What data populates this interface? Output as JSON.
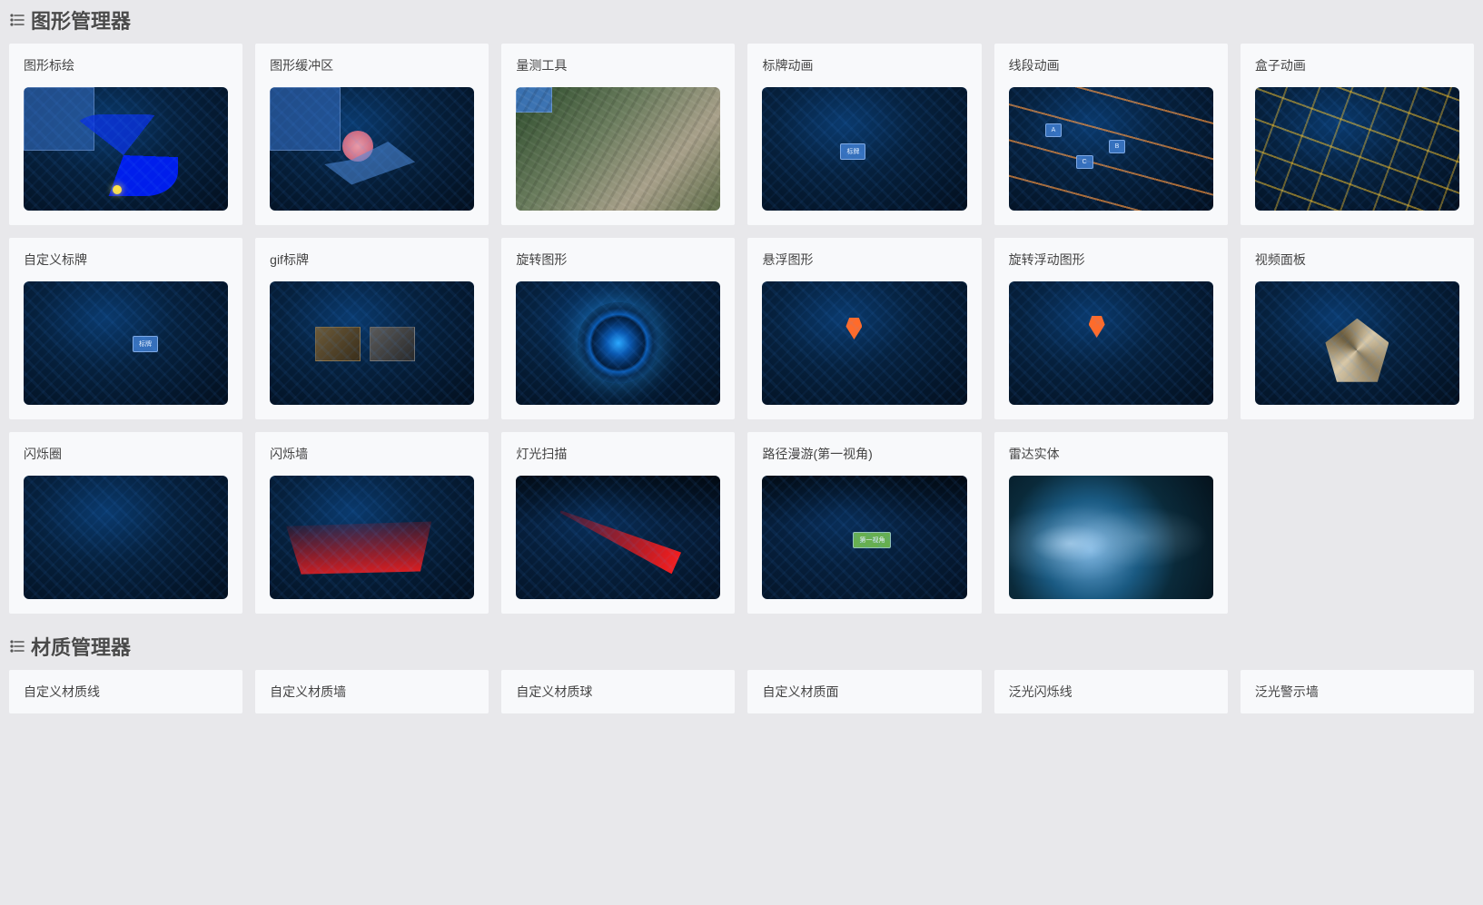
{
  "sections": [
    {
      "title": "图形管理器",
      "items": [
        "图形标绘",
        "图形缓冲区",
        "量测工具",
        "标牌动画",
        "线段动画",
        "盒子动画",
        "自定义标牌",
        "gif标牌",
        "旋转图形",
        "悬浮图形",
        "旋转浮动图形",
        "视频面板",
        "闪烁圈",
        "闪烁墙",
        "灯光扫描",
        "路径漫游(第一视角)",
        "雷达实体"
      ]
    },
    {
      "title": "材质管理器",
      "items": [
        "自定义材质线",
        "自定义材质墙",
        "自定义材质球",
        "自定义材质面",
        "泛光闪烁线",
        "泛光警示墙"
      ]
    }
  ]
}
